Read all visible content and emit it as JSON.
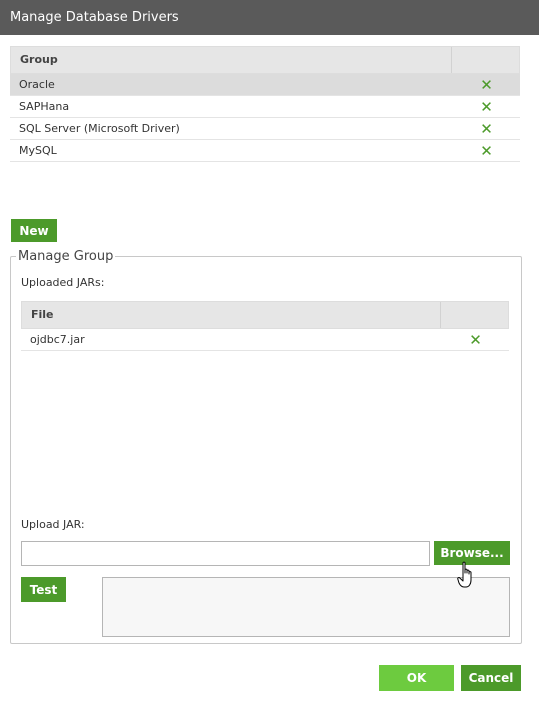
{
  "window": {
    "title": "Manage Database Drivers"
  },
  "groups_table": {
    "header": "Group",
    "delete_icon": "close-icon",
    "rows": [
      {
        "label": "Oracle",
        "selected": true
      },
      {
        "label": "SAPHana",
        "selected": false
      },
      {
        "label": "SQL Server (Microsoft Driver)",
        "selected": false
      },
      {
        "label": "MySQL",
        "selected": false
      }
    ]
  },
  "new_button": "New",
  "manage_group": {
    "legend": "Manage Group",
    "uploaded_label": "Uploaded JARs:",
    "files_table": {
      "header": "File",
      "rows": [
        {
          "label": "ojdbc7.jar"
        }
      ]
    },
    "upload_label": "Upload JAR:",
    "upload_value": "",
    "browse_button": "Browse...",
    "test_button": "Test",
    "test_output": ""
  },
  "footer": {
    "ok_button": "OK",
    "cancel_button": "Cancel"
  },
  "colors": {
    "title_bar": "#5a5a5a",
    "primary_green": "#4c9a2a",
    "ok_green": "#6dcb3f",
    "selected_row": "#dcdcdc"
  }
}
